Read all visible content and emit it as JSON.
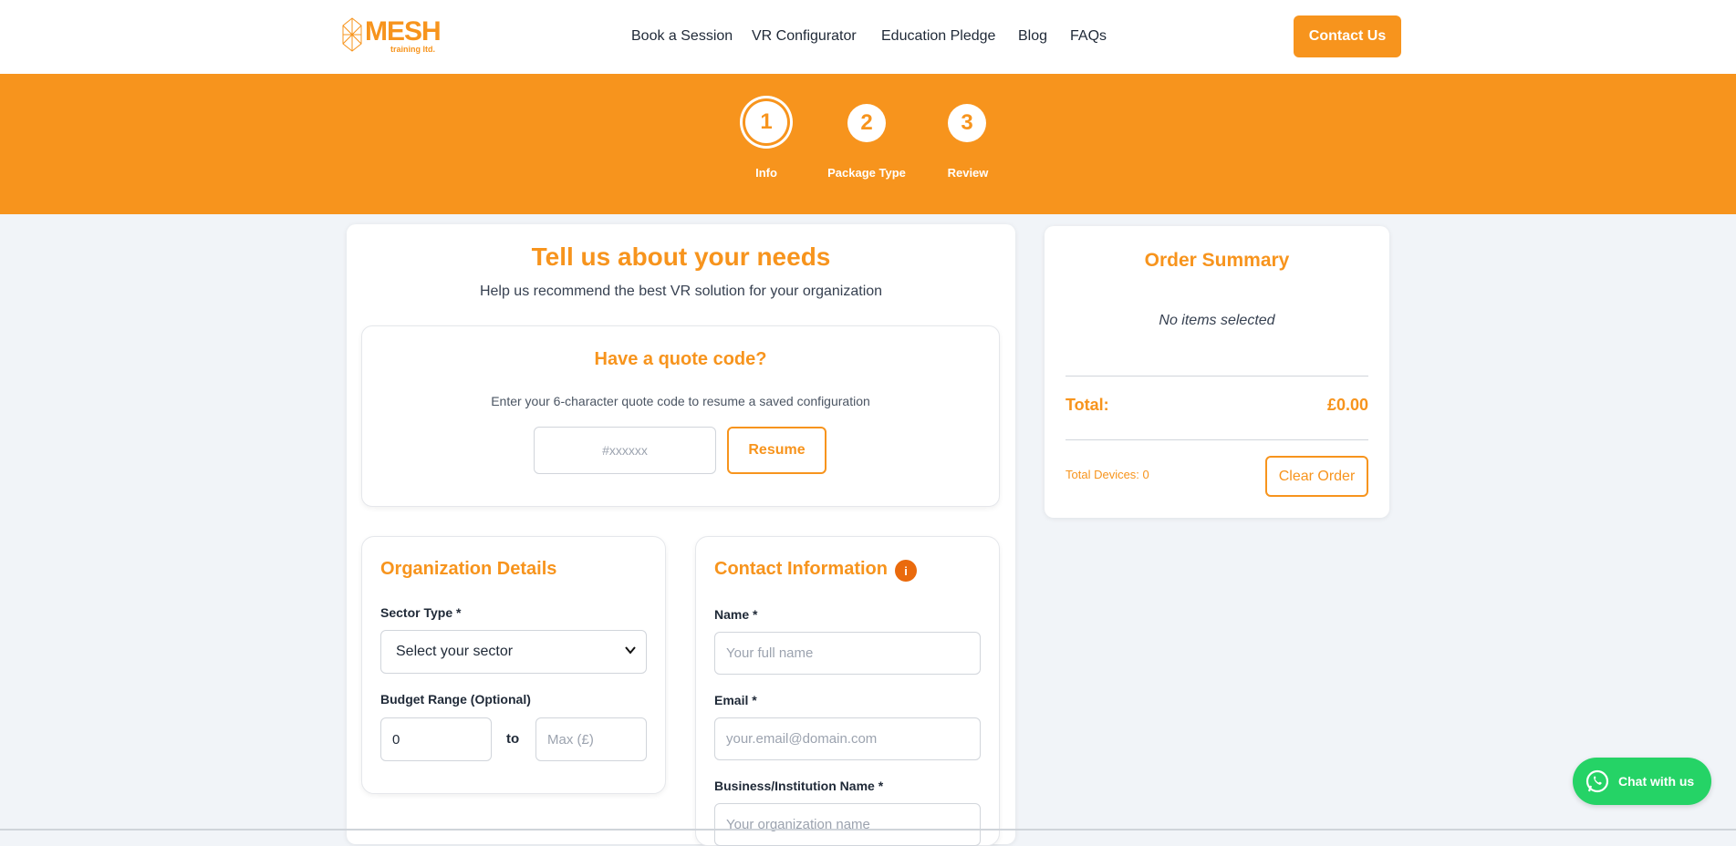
{
  "header": {
    "logo_text": "MESH",
    "logo_sub": "training ltd.",
    "nav": [
      "Book a Session",
      "VR Configurator",
      "Education Pledge",
      "Blog",
      "FAQs"
    ],
    "contact_label": "Contact Us"
  },
  "stepper": {
    "steps": [
      {
        "number": "1",
        "label": "Info",
        "active": true
      },
      {
        "number": "2",
        "label": "Package Type",
        "active": false
      },
      {
        "number": "3",
        "label": "Review",
        "active": false
      }
    ]
  },
  "main": {
    "title": "Tell us about your needs",
    "subtitle": "Help us recommend the best VR solution for your organization",
    "quote": {
      "title": "Have a quote code?",
      "description": "Enter your 6-character quote code to resume a saved configuration",
      "placeholder": "#xxxxxx",
      "resume_label": "Resume"
    },
    "organization": {
      "title": "Organization Details",
      "sector_label": "Sector Type *",
      "sector_value": "Select your sector",
      "budget_label": "Budget Range (Optional)",
      "budget_min": "0",
      "to_label": "to",
      "budget_max_placeholder": "Max (£)"
    },
    "contact": {
      "title": "Contact Information",
      "info_icon": "i",
      "name_label": "Name *",
      "name_placeholder": "Your full name",
      "email_label": "Email *",
      "email_placeholder": "your.email@domain.com",
      "business_label": "Business/Institution Name *",
      "business_placeholder": "Your organization name"
    }
  },
  "summary": {
    "title": "Order Summary",
    "empty": "No items selected",
    "total_label": "Total:",
    "total_value": "£0.00",
    "devices": "Total Devices: 0",
    "clear_label": "Clear Order"
  },
  "chat": {
    "label": "Chat with us"
  },
  "colors": {
    "accent": "#f7941d",
    "background": "#f1f4f8",
    "whatsapp": "#25d366"
  }
}
